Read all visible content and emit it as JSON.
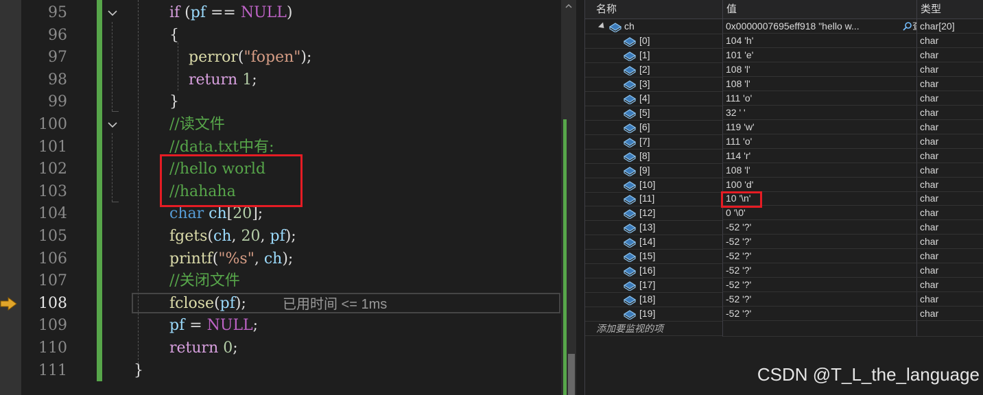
{
  "editor": {
    "line_numbers": [
      "95",
      "96",
      "97",
      "98",
      "99",
      "100",
      "101",
      "102",
      "103",
      "104",
      "105",
      "106",
      "107",
      "108",
      "109",
      "110",
      "111"
    ],
    "current_line": "108",
    "lines": [
      [
        {
          "t": "if",
          "c": "ctl"
        },
        {
          "t": " (",
          "c": ""
        },
        {
          "t": "pf",
          "c": "var"
        },
        {
          "t": " == ",
          "c": ""
        },
        {
          "t": "NULL",
          "c": "macro"
        },
        {
          "t": ")",
          "c": ""
        }
      ],
      [
        {
          "t": "{",
          "c": ""
        }
      ],
      [
        {
          "t": "    ",
          "c": ""
        },
        {
          "t": "perror",
          "c": "fn"
        },
        {
          "t": "(",
          "c": ""
        },
        {
          "t": "\"fopen\"",
          "c": "str"
        },
        {
          "t": ");",
          "c": ""
        }
      ],
      [
        {
          "t": "    ",
          "c": ""
        },
        {
          "t": "return",
          "c": "ctl"
        },
        {
          "t": " ",
          "c": ""
        },
        {
          "t": "1",
          "c": "num"
        },
        {
          "t": ";",
          "c": ""
        }
      ],
      [
        {
          "t": "}",
          "c": ""
        }
      ],
      [
        {
          "t": "//读文件",
          "c": "cm"
        }
      ],
      [
        {
          "t": "//data.txt中有:",
          "c": "cm"
        }
      ],
      [
        {
          "t": "//hello world",
          "c": "cm"
        }
      ],
      [
        {
          "t": "//hahaha",
          "c": "cm"
        }
      ],
      [
        {
          "t": "char",
          "c": "kw"
        },
        {
          "t": " ",
          "c": ""
        },
        {
          "t": "ch",
          "c": "var"
        },
        {
          "t": "[",
          "c": ""
        },
        {
          "t": "20",
          "c": "num"
        },
        {
          "t": "];",
          "c": ""
        }
      ],
      [
        {
          "t": "fgets",
          "c": "fn"
        },
        {
          "t": "(",
          "c": ""
        },
        {
          "t": "ch",
          "c": "var"
        },
        {
          "t": ", ",
          "c": ""
        },
        {
          "t": "20",
          "c": "num"
        },
        {
          "t": ", ",
          "c": ""
        },
        {
          "t": "pf",
          "c": "var"
        },
        {
          "t": ");",
          "c": ""
        }
      ],
      [
        {
          "t": "printf",
          "c": "fn"
        },
        {
          "t": "(",
          "c": ""
        },
        {
          "t": "\"%s\"",
          "c": "str"
        },
        {
          "t": ", ",
          "c": ""
        },
        {
          "t": "ch",
          "c": "var"
        },
        {
          "t": ");",
          "c": ""
        }
      ],
      [
        {
          "t": "//关闭文件",
          "c": "cm"
        }
      ],
      [
        {
          "t": "fclose",
          "c": "fn"
        },
        {
          "t": "(",
          "c": ""
        },
        {
          "t": "pf",
          "c": "var"
        },
        {
          "t": ");",
          "c": ""
        }
      ],
      [
        {
          "t": "pf",
          "c": "var"
        },
        {
          "t": " = ",
          "c": ""
        },
        {
          "t": "NULL",
          "c": "macro"
        },
        {
          "t": ";",
          "c": ""
        }
      ],
      [
        {
          "t": "return",
          "c": "ctl"
        },
        {
          "t": " ",
          "c": ""
        },
        {
          "t": "0",
          "c": "num"
        },
        {
          "t": ";",
          "c": ""
        }
      ],
      [
        {
          "t": "}",
          "c": ""
        }
      ]
    ],
    "perf_tip": "已用时间 <= 1ms"
  },
  "watch": {
    "headers": {
      "name": "名称",
      "value": "值",
      "type": "类型"
    },
    "root": {
      "name": "ch",
      "value": "0x0000007695eff918 \"hello w...",
      "view_label": "查看",
      "type": "char[20]"
    },
    "items": [
      {
        "name": "[0]",
        "value": "104 'h'",
        "type": "char"
      },
      {
        "name": "[1]",
        "value": "101 'e'",
        "type": "char"
      },
      {
        "name": "[2]",
        "value": "108 'l'",
        "type": "char"
      },
      {
        "name": "[3]",
        "value": "108 'l'",
        "type": "char"
      },
      {
        "name": "[4]",
        "value": "111 'o'",
        "type": "char"
      },
      {
        "name": "[5]",
        "value": "32 ' '",
        "type": "char"
      },
      {
        "name": "[6]",
        "value": "119 'w'",
        "type": "char"
      },
      {
        "name": "[7]",
        "value": "111 'o'",
        "type": "char"
      },
      {
        "name": "[8]",
        "value": "114 'r'",
        "type": "char"
      },
      {
        "name": "[9]",
        "value": "108 'l'",
        "type": "char"
      },
      {
        "name": "[10]",
        "value": "100 'd'",
        "type": "char"
      },
      {
        "name": "[11]",
        "value": "10 '\\n'",
        "type": "char"
      },
      {
        "name": "[12]",
        "value": "0 '\\0'",
        "type": "char"
      },
      {
        "name": "[13]",
        "value": "-52 '?'",
        "type": "char"
      },
      {
        "name": "[14]",
        "value": "-52 '?'",
        "type": "char"
      },
      {
        "name": "[15]",
        "value": "-52 '?'",
        "type": "char"
      },
      {
        "name": "[16]",
        "value": "-52 '?'",
        "type": "char"
      },
      {
        "name": "[17]",
        "value": "-52 '?'",
        "type": "char"
      },
      {
        "name": "[18]",
        "value": "-52 '?'",
        "type": "char"
      },
      {
        "name": "[19]",
        "value": "-52 '?'",
        "type": "char"
      }
    ],
    "add_item_label": "添加要监视的项"
  },
  "watermark": "CSDN @T_L_the_language",
  "colors": {
    "highlight_box": "#e51c24",
    "change_bar": "#57a64a",
    "exec_arrow": "#e0a52a"
  }
}
